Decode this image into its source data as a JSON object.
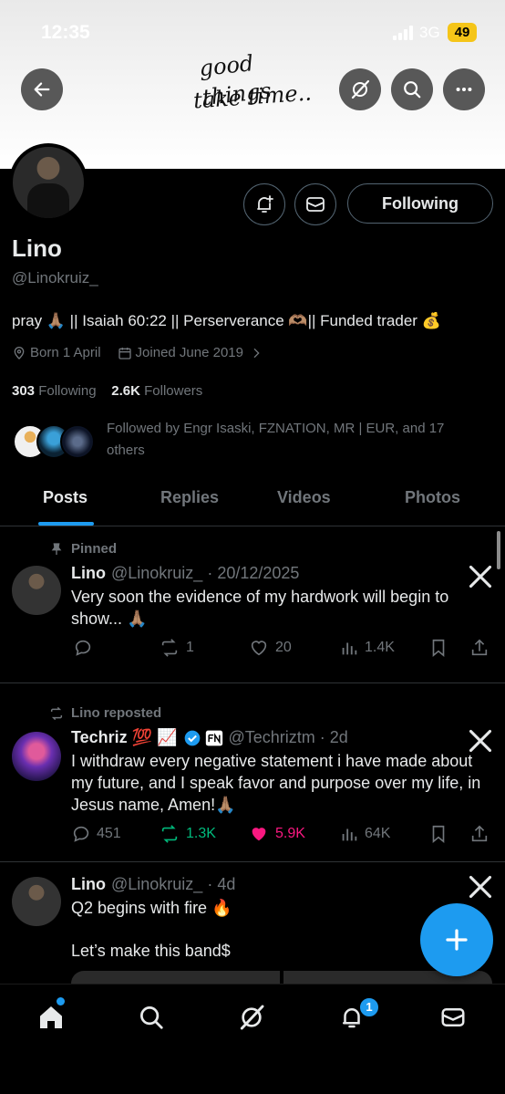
{
  "status_bar": {
    "time": "12:35",
    "network": "3G",
    "battery": "49"
  },
  "banner": {
    "line1": "good things",
    "line2": "take time.."
  },
  "profile": {
    "name": "Lino",
    "handle": "@Linokruiz_",
    "bio": "pray 🙏🏽 || Isaiah 60:22 || Perserverance 🫶🏽|| Funded trader 💰",
    "born": "Born 1 April",
    "joined": "Joined June 2019",
    "following_count": "303",
    "following_label": "Following",
    "followers_count": "2.6K",
    "followers_label": "Followers",
    "followed_by": "Followed by Engr Isaski, FZNATION, MR | EUR, and 17 others",
    "follow_button": "Following"
  },
  "tabs": [
    "Posts",
    "Replies",
    "Videos",
    "Photos"
  ],
  "posts": [
    {
      "context": "Pinned",
      "name": "Lino",
      "handle": "@Linokruiz_ · 20/12/2025",
      "text": "Very soon the evidence of my hardwork will begin to show... 🙏🏽",
      "replies": "",
      "reposts": "1",
      "likes": "20",
      "views": "1.4K"
    },
    {
      "context": "Lino reposted",
      "name": "Techriz 💯 📈",
      "handle": "@Techriztm · 2d",
      "text": "I withdraw every negative statement i have made about my future, and I speak favor and purpose over my life, in Jesus name, Amen!🙏🏽",
      "replies": "451",
      "reposts": "1.3K",
      "likes": "5.9K",
      "views": "64K"
    },
    {
      "name": "Lino",
      "handle": "@Linokruiz_ · 4d",
      "text_line1": "Q2 begins with fire 🔥",
      "text_line2": "Let’s make this band$"
    }
  ],
  "nav": {
    "notifications_badge": "1"
  },
  "colors": {
    "accent": "#1d9bf0",
    "like": "#f91880",
    "repost": "#00ba7c",
    "muted": "#71767b"
  }
}
